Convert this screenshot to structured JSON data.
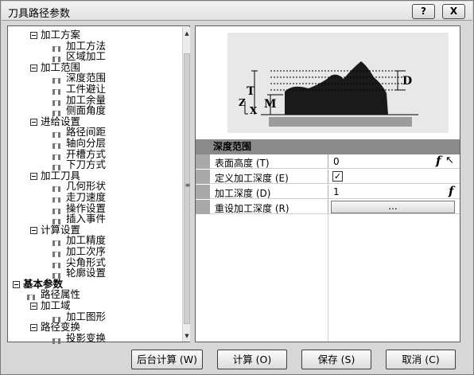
{
  "window": {
    "title": "刀具路径参数",
    "help_label": "?",
    "close_label": "X"
  },
  "tree": {
    "items": [
      {
        "label": "加工方案",
        "level": 1,
        "expanded": true
      },
      {
        "label": "加工方法",
        "level": 2
      },
      {
        "label": "区域加工",
        "level": 2
      },
      {
        "label": "加工范围",
        "level": 1,
        "expanded": true
      },
      {
        "label": "深度范围",
        "level": 2
      },
      {
        "label": "工件避让",
        "level": 2
      },
      {
        "label": "加工余量",
        "level": 2
      },
      {
        "label": "侧面角度",
        "level": 2
      },
      {
        "label": "进给设置",
        "level": 1,
        "expanded": true
      },
      {
        "label": "路径间距",
        "level": 2
      },
      {
        "label": "轴向分层",
        "level": 2
      },
      {
        "label": "开槽方式",
        "level": 2
      },
      {
        "label": "下刀方式",
        "level": 2
      },
      {
        "label": "加工刀具",
        "level": 1,
        "expanded": true
      },
      {
        "label": "几何形状",
        "level": 2
      },
      {
        "label": "走刀速度",
        "level": 2
      },
      {
        "label": "操作设置",
        "level": 2
      },
      {
        "label": "插入事件",
        "level": 2
      },
      {
        "label": "计算设置",
        "level": 1,
        "expanded": true
      },
      {
        "label": "加工精度",
        "level": 2
      },
      {
        "label": "加工次序",
        "level": 2
      },
      {
        "label": "尖角形式",
        "level": 2
      },
      {
        "label": "轮廓设置",
        "level": 2
      },
      {
        "label": "基本参数",
        "level": 0,
        "expanded": true
      },
      {
        "label": "路径属性",
        "level": 1
      },
      {
        "label": "加工域",
        "level": 1,
        "expanded": true
      },
      {
        "label": "加工图形",
        "level": 2
      },
      {
        "label": "路径变换",
        "level": 1,
        "expanded": true
      },
      {
        "label": "投影变换",
        "level": 2
      }
    ]
  },
  "illustration": {
    "labels": {
      "t": "T",
      "m": "M",
      "d": "D",
      "z": "Z",
      "x": "X"
    }
  },
  "properties": {
    "section_title": "深度范围",
    "rows": [
      {
        "label": "表面高度 (T)",
        "value": "0",
        "icon": "function-icon"
      },
      {
        "label": "定义加工深度 (E)",
        "checked": true
      },
      {
        "label": "加工深度 (D)",
        "value": "1",
        "icon": "function-icon"
      },
      {
        "label": "重设加工深度 (R)",
        "button": "..."
      }
    ],
    "function_glyph": "f"
  },
  "buttons": {
    "background_calc": "后台计算 (W)",
    "calc": "计算 (O)",
    "save": "保存 (S)",
    "cancel": "取消 (C)"
  }
}
